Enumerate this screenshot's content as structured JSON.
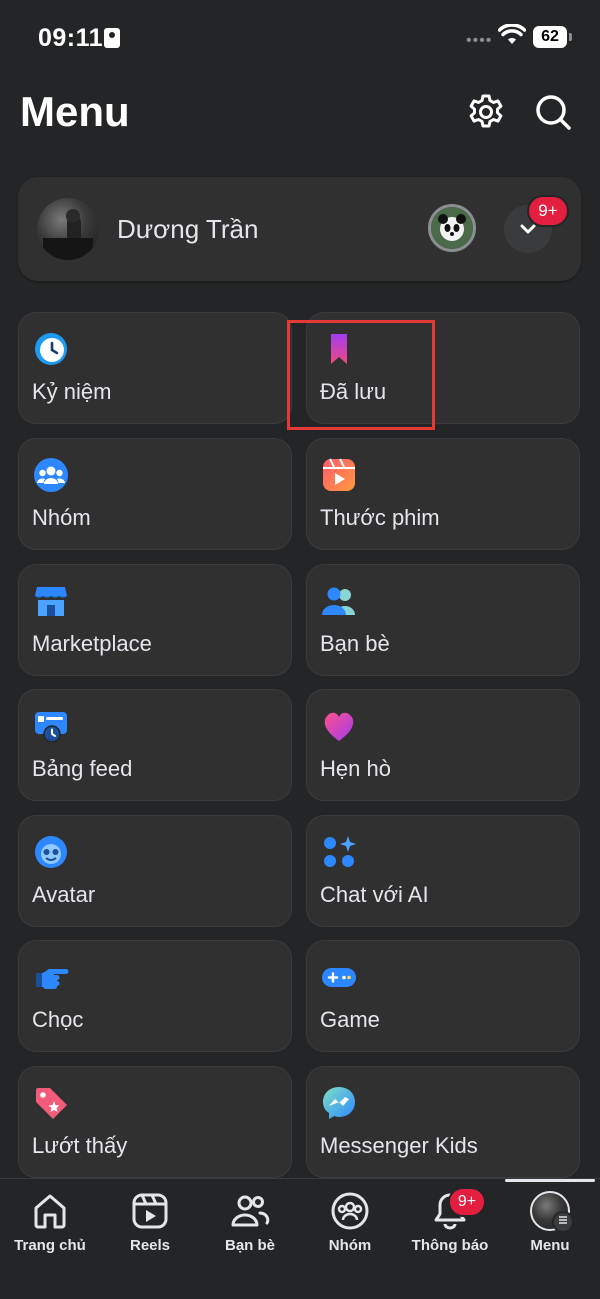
{
  "status_bar": {
    "time": "09:11",
    "battery": "62"
  },
  "header": {
    "title": "Menu"
  },
  "profile": {
    "name": "Dương Trần",
    "notification_badge": "9+"
  },
  "shortcuts": [
    {
      "label": "Kỷ niệm",
      "icon": "memories-clock-icon"
    },
    {
      "label": "Đã lưu",
      "icon": "saved-bookmark-icon"
    },
    {
      "label": "Nhóm",
      "icon": "groups-icon"
    },
    {
      "label": "Thước phim",
      "icon": "reels-icon"
    },
    {
      "label": "Marketplace",
      "icon": "marketplace-store-icon"
    },
    {
      "label": "Bạn bè",
      "icon": "friends-icon"
    },
    {
      "label": "Bảng feed",
      "icon": "feed-icon"
    },
    {
      "label": "Hẹn hò",
      "icon": "dating-heart-icon"
    },
    {
      "label": "Avatar",
      "icon": "avatar-face-icon"
    },
    {
      "label": "Chat với AI",
      "icon": "ai-chat-icon"
    },
    {
      "label": "Chọc",
      "icon": "poke-hand-icon"
    },
    {
      "label": "Game",
      "icon": "gamepad-icon"
    },
    {
      "label": "Lướt thấy",
      "icon": "tag-icon"
    },
    {
      "label": "Messenger Kids",
      "icon": "messenger-kids-icon"
    }
  ],
  "tabbar": {
    "items": [
      {
        "label": "Trang chủ"
      },
      {
        "label": "Reels"
      },
      {
        "label": "Bạn bè"
      },
      {
        "label": "Nhóm"
      },
      {
        "label": "Thông báo"
      },
      {
        "label": "Menu"
      }
    ],
    "notification_badge": "9+",
    "active": "Menu"
  },
  "colors": {
    "background": "#242526",
    "card": "#303031",
    "badge": "#e41e3f",
    "highlight": "#e53935"
  }
}
